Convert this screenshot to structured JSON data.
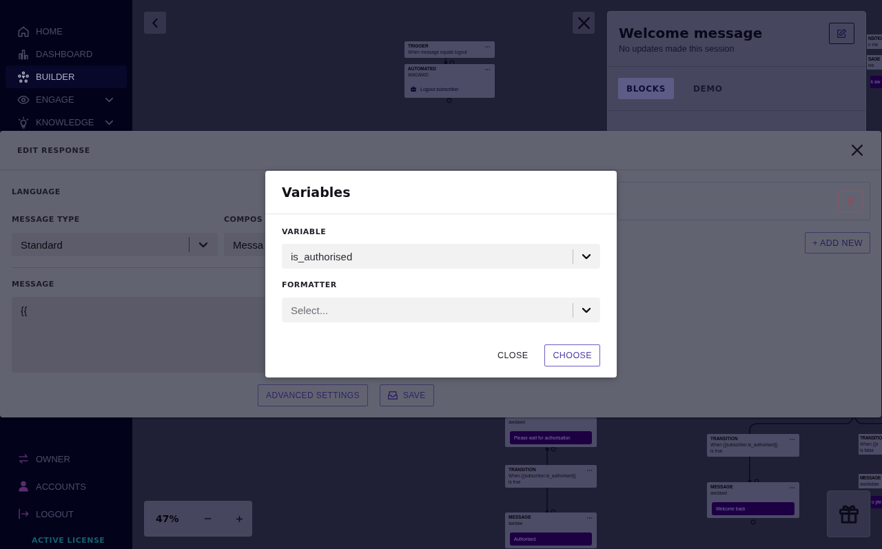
{
  "sidebar": {
    "items": [
      {
        "label": "HOME",
        "selected": false,
        "has_submenu": false
      },
      {
        "label": "DASHBOARD",
        "selected": false,
        "has_submenu": false
      },
      {
        "label": "BUILDER",
        "selected": true,
        "has_submenu": false
      },
      {
        "label": "ENGAGE",
        "selected": false,
        "has_submenu": true
      },
      {
        "label": "KNOWLEDGE",
        "selected": false,
        "has_submenu": true
      }
    ],
    "bottom_items": [
      {
        "label": "OWNER"
      },
      {
        "label": "ACCOUNTS"
      },
      {
        "label": "LOGOUT"
      }
    ],
    "license_status": "ACTIVE LICENSE"
  },
  "canvas": {
    "nodes": [
      {
        "kind": "trigger",
        "title": "TRIGGER",
        "lines": [
          "When message equals logout"
        ]
      },
      {
        "kind": "automated",
        "title": "AUTOMATED",
        "lines": [
          "WADAWD"
        ],
        "action": "Logout subscriber"
      },
      {
        "kind": "message",
        "lines": [
          "awdawd"
        ],
        "bubble": "Please wait for authorisation"
      },
      {
        "kind": "transition",
        "title": "TRANSITION",
        "lines": [
          "When {{subscriber.is_authorised}}",
          "is true"
        ]
      },
      {
        "kind": "message",
        "title": "MESSAGE",
        "lines": [
          "awdaw"
        ],
        "bubble": "Authorised."
      },
      {
        "kind": "transition",
        "title": "TRANSITION",
        "lines": [
          "When {{subscriber.is_authorised}}",
          "is true"
        ]
      },
      {
        "kind": "message",
        "title": "MESSAGE",
        "lines": [
          "awdawd"
        ],
        "bubble": "Welcome back"
      },
      {
        "kind": "fragment",
        "title": "NSITIO",
        "lines": [
          "n me"
        ]
      },
      {
        "kind": "fragment",
        "title": "SAGE",
        "lines": [
          "wa"
        ]
      },
      {
        "kind": "fragment",
        "bubble": "k aw"
      },
      {
        "kind": "fragment",
        "title": "TRANSITIO",
        "lines": [
          "When {{s",
          "is false"
        ]
      },
      {
        "kind": "fragment",
        "title": "MESSAGE",
        "lines": [
          "awdadaw"
        ]
      },
      {
        "kind": "fragment",
        "bubble": "o ple"
      }
    ],
    "zoom_level": "47%"
  },
  "flow_panel": {
    "title": "Welcome message",
    "subtitle": "No updates made this session",
    "tabs": [
      {
        "label": "BLOCKS",
        "selected": true
      },
      {
        "label": "DEMO",
        "selected": false
      }
    ]
  },
  "edit_response": {
    "title": "EDIT RESPONSE",
    "language_label": "LANGUAGE",
    "message_type": {
      "label": "MESSAGE TYPE",
      "value": "Standard"
    },
    "composer": {
      "label": "COMPOS",
      "value": "Messa"
    },
    "message": {
      "label": "MESSAGE",
      "value": "{{"
    },
    "buttons": [
      {
        "label": "ADVANCED SETTINGS",
        "kind": "plain"
      },
      {
        "label": "SAVE",
        "kind": "save"
      }
    ],
    "add_new_button": "+ ADD NEW"
  },
  "variables_dialog": {
    "title": "Variables",
    "fields": [
      {
        "label": "VARIABLE",
        "value": "is_authorised"
      },
      {
        "label": "FORMATTER",
        "placeholder": "Select..."
      }
    ],
    "buttons": [
      {
        "label": "CLOSE",
        "kind": "text"
      },
      {
        "label": "CHOOSE",
        "kind": "outline"
      }
    ]
  }
}
